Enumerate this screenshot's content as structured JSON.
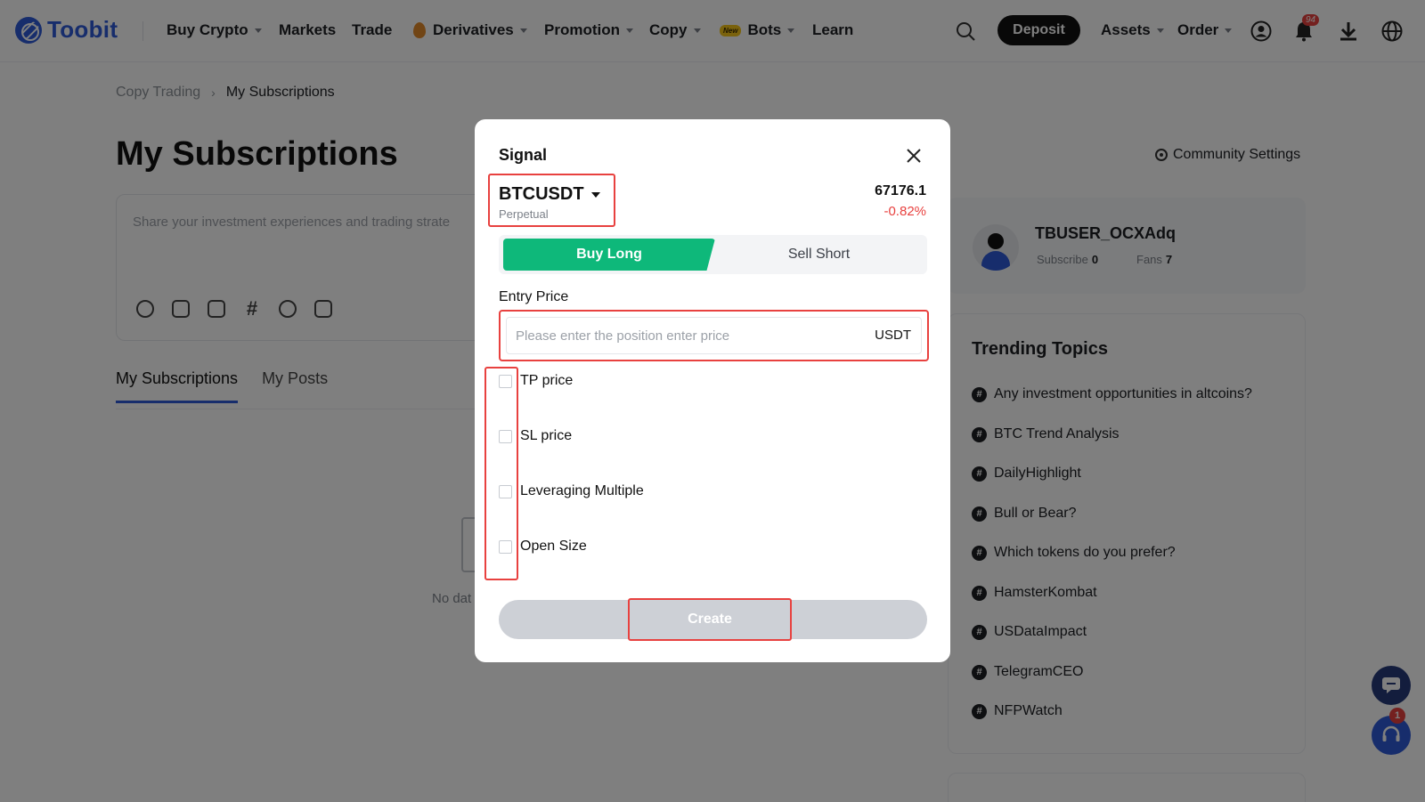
{
  "nav": {
    "brand": "Toobit",
    "items": [
      {
        "label": "Buy Crypto"
      },
      {
        "label": "Markets"
      },
      {
        "label": "Trade"
      },
      {
        "label": "Derivatives"
      },
      {
        "label": "Promotion"
      },
      {
        "label": "Copy"
      },
      {
        "label": "Bots",
        "badge": "New"
      },
      {
        "label": "Learn"
      }
    ],
    "deposit_label": "Deposit",
    "assets_label": "Assets",
    "order_label": "Order",
    "notification_count": "94",
    "icons": [
      "search-icon",
      "user-icon",
      "bell-icon",
      "download-icon",
      "globe-icon"
    ]
  },
  "breadcrumb": {
    "parent": "Copy Trading",
    "current": "My Subscriptions"
  },
  "page": {
    "title": "My Subscriptions",
    "community_settings": "Community Settings",
    "post_placeholder": "Share your investment experiences and trading strate",
    "tabs": [
      {
        "label": "My Subscriptions"
      },
      {
        "label": "My Posts"
      }
    ],
    "empty_text": "No dat"
  },
  "profile": {
    "username": "TBUSER_OCXAdq",
    "subscribe_label": "Subscribe",
    "subscribe_count": "0",
    "fans_label": "Fans",
    "fans_count": "7"
  },
  "trending": {
    "title": "Trending Topics",
    "topics": [
      "Any investment opportunities in altcoins?",
      "BTC Trend Analysis",
      "DailyHighlight",
      "Bull or Bear?",
      "Which tokens do you prefer?",
      "HamsterKombat",
      "USDataImpact",
      "TelegramCEO",
      "NFPWatch"
    ]
  },
  "support": {
    "badge_count": "1"
  },
  "modal": {
    "title": "Signal",
    "pair": "BTCUSDT",
    "pair_type": "Perpetual",
    "price": "67176.1",
    "change": "-0.82%",
    "buy_label": "Buy Long",
    "sell_label": "Sell Short",
    "entry_label": "Entry Price",
    "entry_placeholder": "Please enter the position enter price",
    "entry_unit": "USDT",
    "options": [
      {
        "label": "TP price",
        "checked": false
      },
      {
        "label": "SL price",
        "checked": false
      },
      {
        "label": "Leveraging Multiple",
        "checked": false
      },
      {
        "label": "Open Size",
        "checked": false
      }
    ],
    "create_label": "Create"
  },
  "colors": {
    "brand": "#2f5bd9",
    "buy": "#0eb87a",
    "negative": "#e8413f",
    "highlight": "#e8413f"
  }
}
